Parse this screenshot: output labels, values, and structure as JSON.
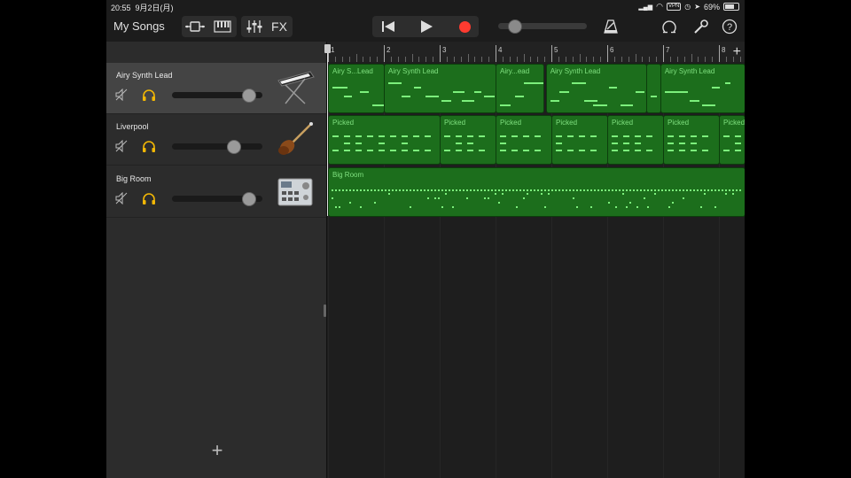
{
  "status": {
    "time": "20:55",
    "date": "9月2日(月)",
    "vpn": "VPN",
    "battery": "69%",
    "battery_level": 0.69
  },
  "toolbar": {
    "my_songs": "My Songs",
    "fx": "FX",
    "master_volume": 0.18
  },
  "colors": {
    "region_green": "#1c6e1c",
    "note_green": "#7cf07c",
    "record_red": "#ff3b30",
    "solo_yellow": "#f2b705"
  },
  "ruler": {
    "bars": [
      "1",
      "2",
      "3",
      "4",
      "5",
      "6",
      "7",
      "8"
    ]
  },
  "tracks": [
    {
      "name": "Airy Synth Lead",
      "instrument": "keyboard-icon",
      "volume": 0.84,
      "selected": true
    },
    {
      "name": "Liverpool",
      "instrument": "bass-guitar-icon",
      "volume": 0.68,
      "selected": false
    },
    {
      "name": "Big Room",
      "instrument": "drum-machine-icon",
      "volume": 0.84,
      "selected": false
    }
  ],
  "regions": [
    {
      "track": 0,
      "label": "Airy S...Lead",
      "start": 1.0,
      "end": 2.0
    },
    {
      "track": 0,
      "label": "Airy Synth Lead",
      "start": 2.0,
      "end": 4.0
    },
    {
      "track": 0,
      "label": "Airy...ead",
      "start": 4.0,
      "end": 4.85
    },
    {
      "track": 0,
      "label": "Airy Synth Lead",
      "start": 4.9,
      "end": 6.7
    },
    {
      "track": 0,
      "label": "",
      "start": 6.7,
      "end": 6.95
    },
    {
      "track": 0,
      "label": "Airy Synth Lead",
      "start": 6.95,
      "end": 8.6
    },
    {
      "track": 1,
      "label": "Picked",
      "start": 1.0,
      "end": 3.0
    },
    {
      "track": 1,
      "label": "Picked",
      "start": 3.0,
      "end": 4.0
    },
    {
      "track": 1,
      "label": "Picked",
      "start": 4.0,
      "end": 5.0
    },
    {
      "track": 1,
      "label": "Picked",
      "start": 5.0,
      "end": 6.0
    },
    {
      "track": 1,
      "label": "Picked",
      "start": 6.0,
      "end": 7.0
    },
    {
      "track": 1,
      "label": "Picked",
      "start": 7.0,
      "end": 8.0
    },
    {
      "track": 1,
      "label": "Picked",
      "start": 8.0,
      "end": 8.6
    },
    {
      "track": 2,
      "label": "Big Room",
      "start": 1.0,
      "end": 8.6
    }
  ]
}
